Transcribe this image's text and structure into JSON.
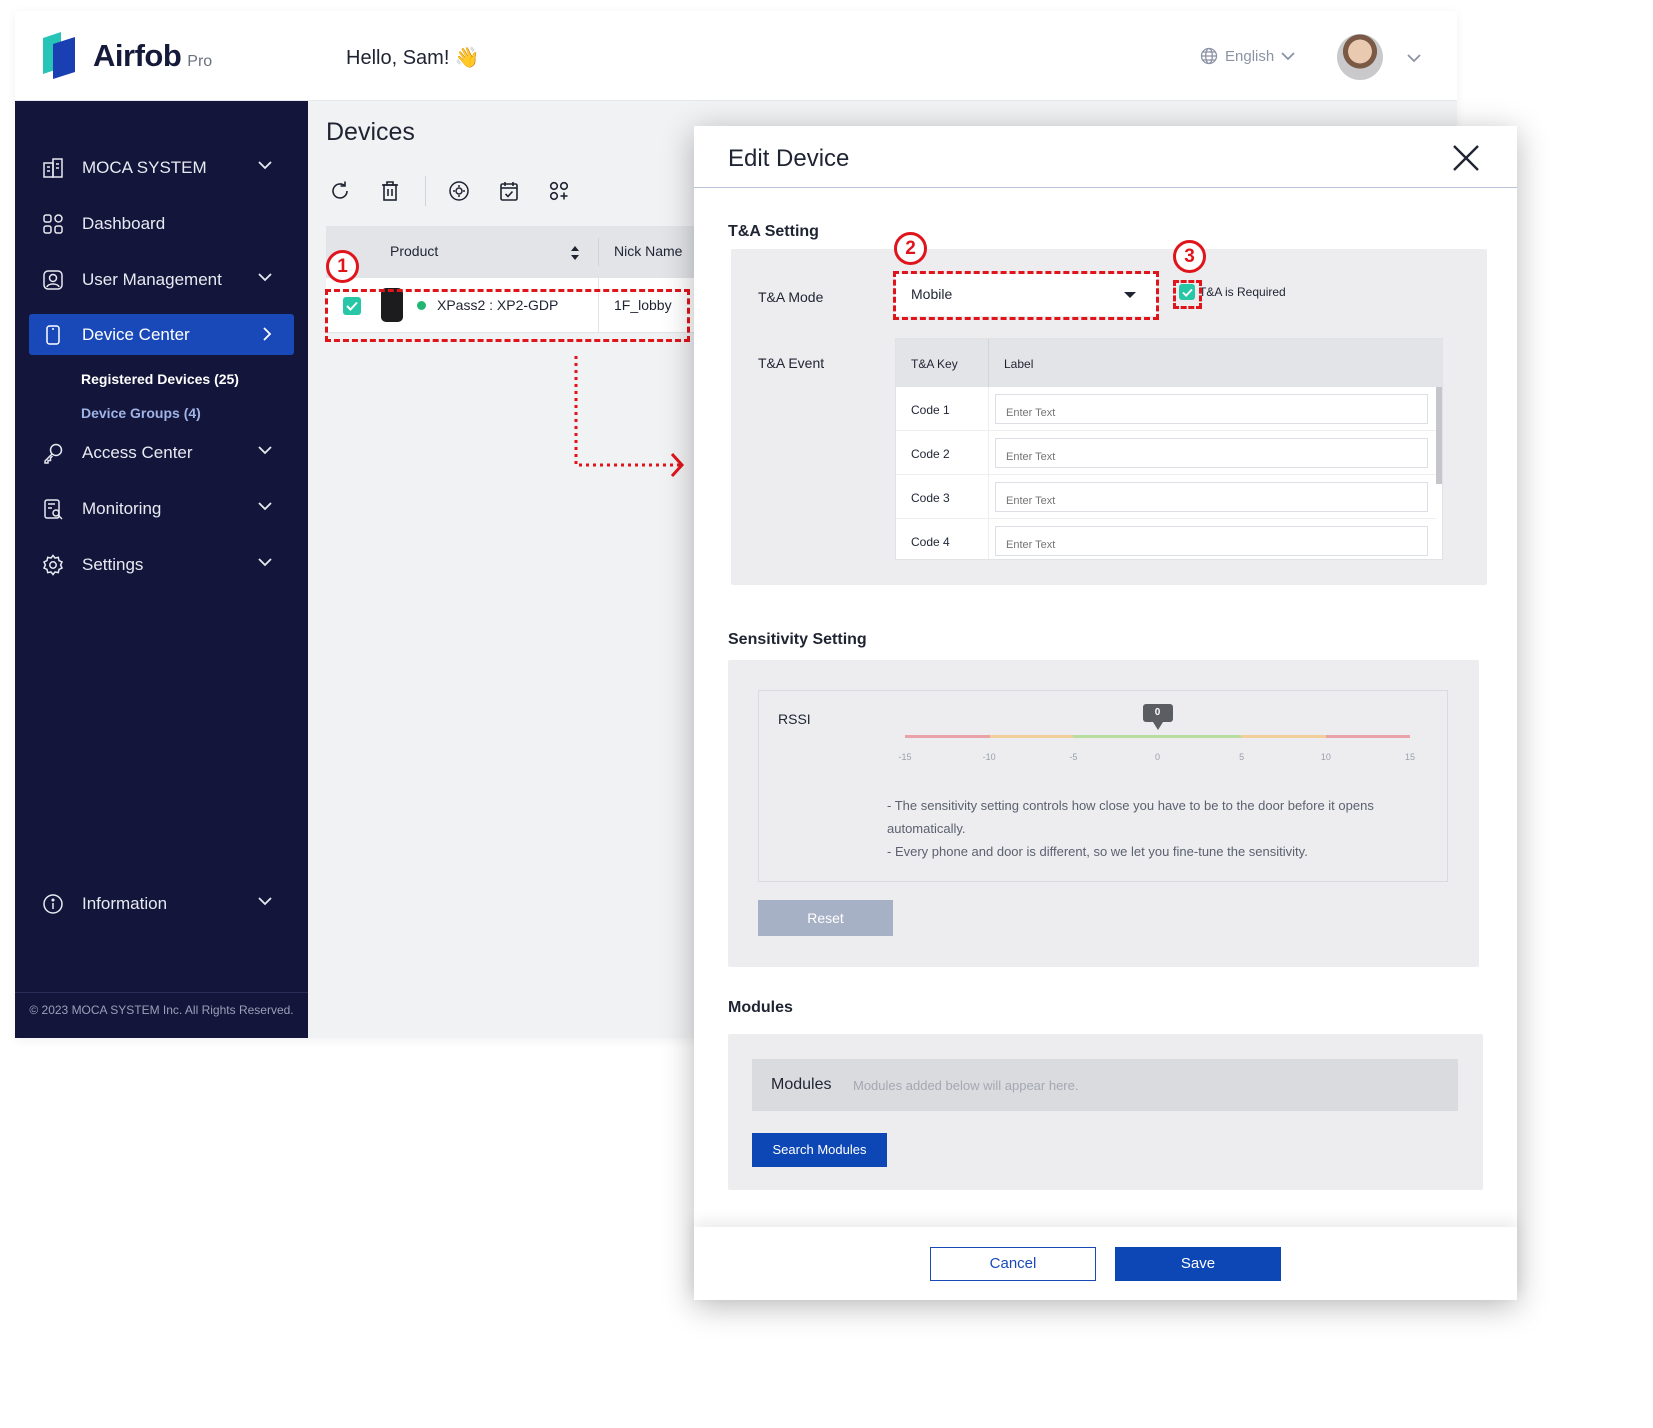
{
  "header": {
    "logo_text": "Airfob",
    "logo_suffix": "Pro",
    "greeting": "Hello, Sam! 👋",
    "language": "English"
  },
  "sidebar": {
    "items": [
      {
        "label": "MOCA SYSTEM",
        "icon": "building-icon"
      },
      {
        "label": "Dashboard",
        "icon": "grid-icon"
      },
      {
        "label": "User Management",
        "icon": "user-icon"
      },
      {
        "label": "Device Center",
        "icon": "device-icon"
      },
      {
        "label": "Access Center",
        "icon": "key-icon"
      },
      {
        "label": "Monitoring",
        "icon": "monitor-icon"
      },
      {
        "label": "Settings",
        "icon": "gear-icon"
      },
      {
        "label": "Information",
        "icon": "info-icon"
      }
    ],
    "sub_items": [
      "Registered Devices (25)",
      "Device Groups  (4)"
    ],
    "copyright": "© 2023 MOCA SYSTEM Inc. All Rights Reserved."
  },
  "main": {
    "title": "Devices",
    "table": {
      "columns": [
        "Product",
        "Nick Name"
      ],
      "rows": [
        {
          "product": "XPass2 : XP2-GDP",
          "nickname": "1F_lobby",
          "status_color": "#22b573"
        }
      ]
    }
  },
  "annotations": [
    "1",
    "2",
    "3"
  ],
  "modal": {
    "title": "Edit Device",
    "ta_section": "T&A Setting",
    "ta_mode_label": "T&A Mode",
    "ta_mode_value": "Mobile",
    "ta_required_label": "T&A is Required",
    "ta_event_label": "T&A Event",
    "event_columns": [
      "T&A Key",
      "Label"
    ],
    "event_rows": [
      {
        "key": "Code 1",
        "placeholder": "Enter Text"
      },
      {
        "key": "Code 2",
        "placeholder": "Enter Text"
      },
      {
        "key": "Code 3",
        "placeholder": "Enter Text"
      },
      {
        "key": "Code 4",
        "placeholder": "Enter Text"
      }
    ],
    "sensitivity_section": "Sensitivity Setting",
    "rssi_label": "RSSI",
    "rssi_value": "0",
    "rssi_ticks": [
      "-15",
      "-10",
      "-5",
      "0",
      "5",
      "10",
      "15"
    ],
    "sensitivity_note_1": "- The sensitivity setting controls how close you have to be to the door before it opens automatically.",
    "sensitivity_note_2": "- Every phone and door is different, so we let you fine-tune the sensitivity.",
    "reset_label": "Reset",
    "modules_section": "Modules",
    "modules_label": "Modules",
    "modules_hint": "Modules added below will appear here.",
    "search_modules_label": "Search Modules",
    "cancel_label": "Cancel",
    "save_label": "Save"
  },
  "colors": {
    "sidebar_bg": "#13153a",
    "accent": "#1949b8",
    "check": "#26c6a6",
    "annotation": "#e0141b"
  }
}
